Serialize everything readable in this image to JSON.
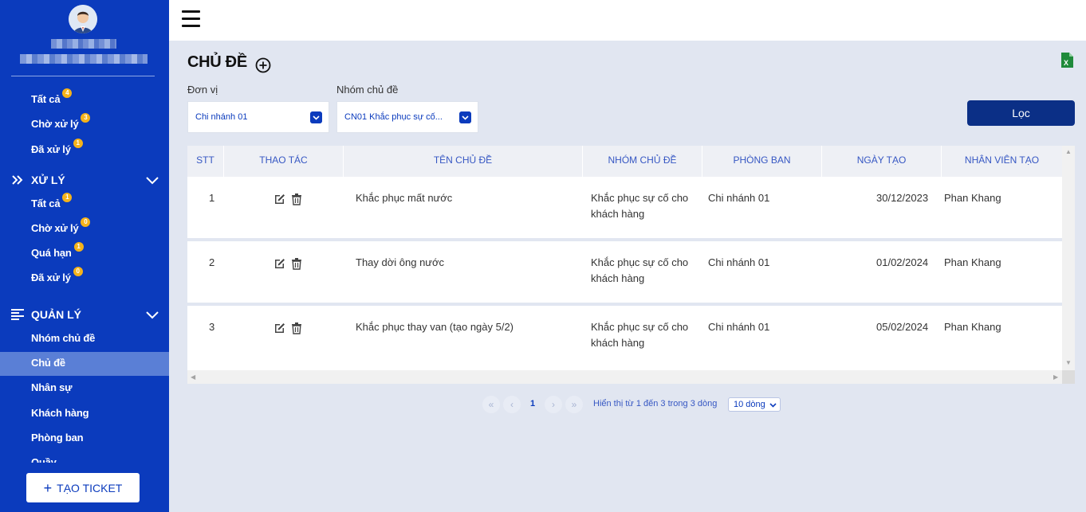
{
  "sidebar": {
    "items_top": [
      {
        "label": "Tất cả",
        "badge": "4"
      },
      {
        "label": "Chờ xử lý",
        "badge": "3"
      },
      {
        "label": "Đã xử lý",
        "badge": "1"
      }
    ],
    "section_process": {
      "title": "XỬ LÝ",
      "items": [
        {
          "label": "Tất cả",
          "badge": "1"
        },
        {
          "label": "Chờ xử lý",
          "badge": "0"
        },
        {
          "label": "Quá hạn",
          "badge": "1"
        },
        {
          "label": "Đã xử lý",
          "badge": "0"
        }
      ]
    },
    "section_manage": {
      "title": "QUẢN LÝ",
      "items": [
        {
          "label": "Nhóm chủ đề"
        },
        {
          "label": "Chủ đề",
          "active": true
        },
        {
          "label": "Nhân sự"
        },
        {
          "label": "Khách hàng"
        },
        {
          "label": "Phòng ban"
        },
        {
          "label": "Quầy"
        }
      ]
    },
    "create_button": "TẠO TICKET",
    "colors": {
      "background": "#0b3bbd",
      "active": "#5a7fd6",
      "badge": "#f5b31b"
    }
  },
  "header": {
    "menu_icon": "hamburger-icon"
  },
  "page": {
    "title": "CHỦ ĐỀ",
    "add_icon": "plus-circle-icon",
    "export_icon": "excel-icon"
  },
  "filters": {
    "unit_label": "Đơn vị",
    "unit_value": "Chi nhánh 01",
    "group_label": "Nhóm chủ đề",
    "group_value": "CN01 Khắc phục sự cố...",
    "filter_button": "Lọc"
  },
  "table": {
    "columns": [
      "STT",
      "THAO TÁC",
      "TÊN CHỦ ĐỀ",
      "NHÓM CHỦ ĐỀ",
      "PHÒNG BAN",
      "NGÀY TẠO",
      "NHÂN VIÊN TẠO"
    ],
    "rows": [
      {
        "stt": "1",
        "name": "Khắc phục mất nước",
        "group_line1": "Khắc phục sự cố cho",
        "group_line2": "khách hàng",
        "dept": "Chi nhánh 01",
        "date": "30/12/2023",
        "creator": "Phan Khang"
      },
      {
        "stt": "2",
        "name": "Thay dời ông nước",
        "group_line1": "Khắc phục sự cố cho",
        "group_line2": "khách hàng",
        "dept": "Chi nhánh 01",
        "date": "01/02/2024",
        "creator": "Phan Khang"
      },
      {
        "stt": "3",
        "name": "Khắc phục thay van (tạo ngày 5/2)",
        "group_line1": "Khắc phục sự cố cho",
        "group_line2": "khách hàng",
        "dept": "Chi nhánh 01",
        "date": "05/02/2024",
        "creator": "Phan Khang"
      }
    ]
  },
  "pagination": {
    "first": "«",
    "prev": "‹",
    "current": "1",
    "next": "›",
    "last": "»",
    "info": "Hiển thị từ 1 đến 3 trong 3 dòng",
    "page_size": "10 dòng"
  }
}
